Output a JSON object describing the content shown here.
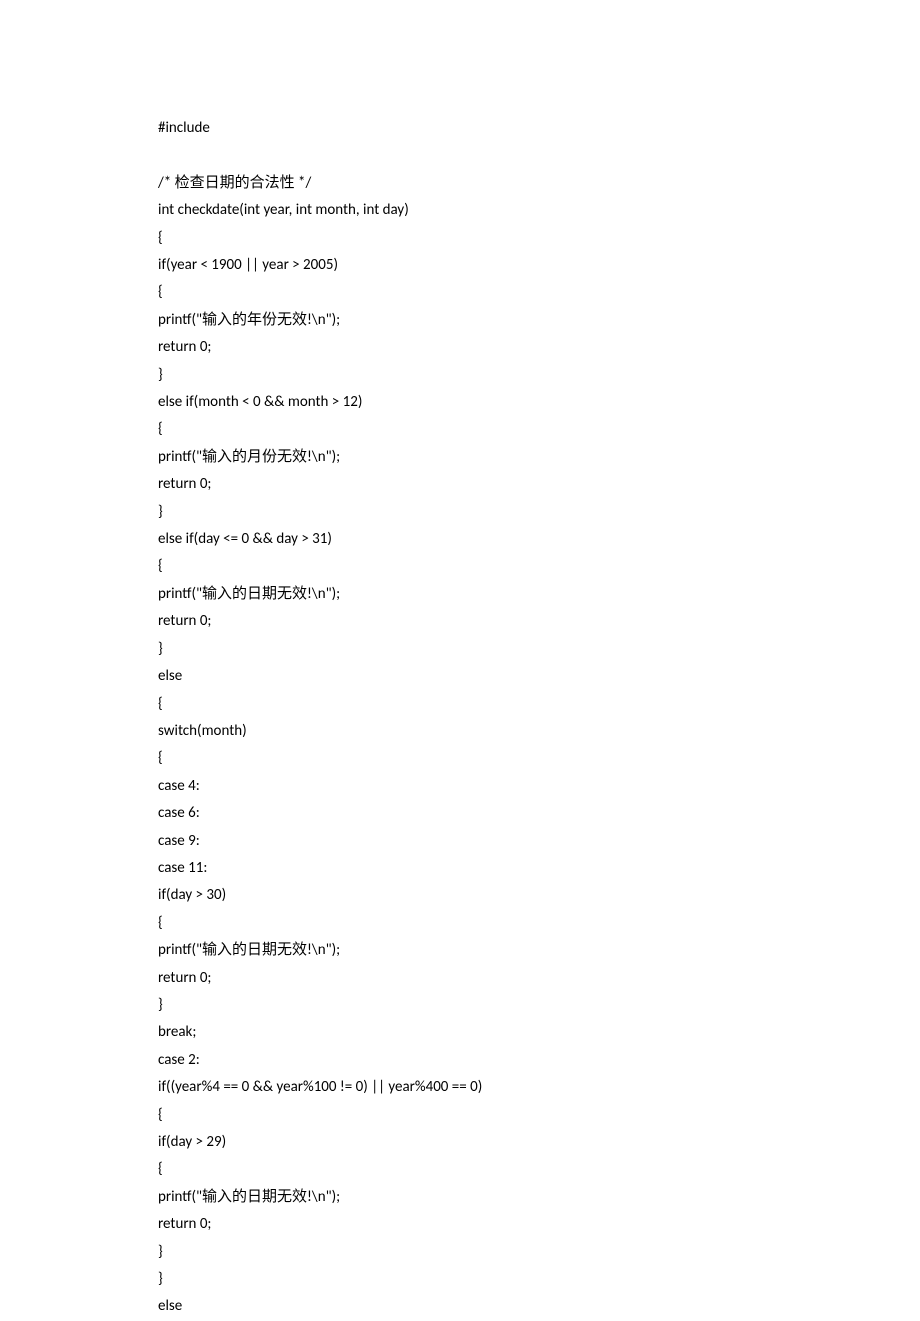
{
  "code": {
    "lines": [
      "#include",
      "",
      "/* 检查日期的合法性 */",
      "int checkdate(int year, int month, int day)",
      "{",
      "if(year < 1900 || year > 2005)",
      "{",
      "printf(\"输入的年份无效!\\n\");",
      "return 0;",
      "}",
      "else if(month < 0 && month > 12)",
      "{",
      "printf(\"输入的月份无效!\\n\");",
      "return 0;",
      "}",
      "else if(day <= 0 && day > 31)",
      "{",
      "printf(\"输入的日期无效!\\n\");",
      "return 0;",
      "}",
      "else",
      "{",
      "switch(month)",
      "{",
      "case 4:",
      "case 6:",
      "case 9:",
      "case 11:",
      "if(day > 30)",
      "{",
      "printf(\"输入的日期无效!\\n\");",
      "return 0;",
      "}",
      "break;",
      "case 2:",
      "if((year%4 == 0 && year%100 != 0) || year%400 == 0)",
      "{",
      "if(day > 29)",
      "{",
      "printf(\"输入的日期无效!\\n\");",
      "return 0;",
      "}",
      "}",
      "else"
    ]
  }
}
